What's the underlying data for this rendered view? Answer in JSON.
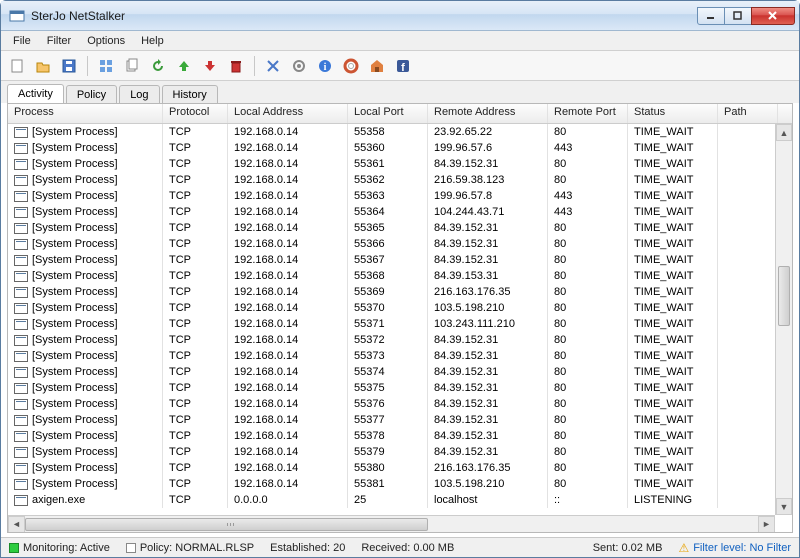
{
  "window": {
    "title": "SterJo NetStalker"
  },
  "menu": {
    "file": "File",
    "filter": "Filter",
    "options": "Options",
    "help": "Help"
  },
  "toolbar_icons": {
    "new": "new",
    "open": "open",
    "save": "save",
    "grid": "grid",
    "copy": "copy",
    "refresh": "refresh",
    "up": "up",
    "down": "down",
    "delete": "delete",
    "kill": "kill",
    "settings": "settings",
    "info": "info",
    "life": "life",
    "home": "home",
    "facebook": "facebook"
  },
  "tabs": {
    "activity": "Activity",
    "policy": "Policy",
    "log": "Log",
    "history": "History"
  },
  "columns": {
    "process": "Process",
    "protocol": "Protocol",
    "local_addr": "Local Address",
    "local_port": "Local Port",
    "remote_addr": "Remote Address",
    "remote_port": "Remote Port",
    "status": "Status",
    "path": "Path"
  },
  "rows": [
    {
      "process": "[System Process]",
      "protocol": "TCP",
      "local_addr": "192.168.0.14",
      "local_port": "55358",
      "remote_addr": "23.92.65.22",
      "remote_port": "80",
      "status": "TIME_WAIT"
    },
    {
      "process": "[System Process]",
      "protocol": "TCP",
      "local_addr": "192.168.0.14",
      "local_port": "55360",
      "remote_addr": "199.96.57.6",
      "remote_port": "443",
      "status": "TIME_WAIT"
    },
    {
      "process": "[System Process]",
      "protocol": "TCP",
      "local_addr": "192.168.0.14",
      "local_port": "55361",
      "remote_addr": "84.39.152.31",
      "remote_port": "80",
      "status": "TIME_WAIT"
    },
    {
      "process": "[System Process]",
      "protocol": "TCP",
      "local_addr": "192.168.0.14",
      "local_port": "55362",
      "remote_addr": "216.59.38.123",
      "remote_port": "80",
      "status": "TIME_WAIT"
    },
    {
      "process": "[System Process]",
      "protocol": "TCP",
      "local_addr": "192.168.0.14",
      "local_port": "55363",
      "remote_addr": "199.96.57.8",
      "remote_port": "443",
      "status": "TIME_WAIT"
    },
    {
      "process": "[System Process]",
      "protocol": "TCP",
      "local_addr": "192.168.0.14",
      "local_port": "55364",
      "remote_addr": "104.244.43.71",
      "remote_port": "443",
      "status": "TIME_WAIT"
    },
    {
      "process": "[System Process]",
      "protocol": "TCP",
      "local_addr": "192.168.0.14",
      "local_port": "55365",
      "remote_addr": "84.39.152.31",
      "remote_port": "80",
      "status": "TIME_WAIT"
    },
    {
      "process": "[System Process]",
      "protocol": "TCP",
      "local_addr": "192.168.0.14",
      "local_port": "55366",
      "remote_addr": "84.39.152.31",
      "remote_port": "80",
      "status": "TIME_WAIT"
    },
    {
      "process": "[System Process]",
      "protocol": "TCP",
      "local_addr": "192.168.0.14",
      "local_port": "55367",
      "remote_addr": "84.39.152.31",
      "remote_port": "80",
      "status": "TIME_WAIT"
    },
    {
      "process": "[System Process]",
      "protocol": "TCP",
      "local_addr": "192.168.0.14",
      "local_port": "55368",
      "remote_addr": "84.39.153.31",
      "remote_port": "80",
      "status": "TIME_WAIT"
    },
    {
      "process": "[System Process]",
      "protocol": "TCP",
      "local_addr": "192.168.0.14",
      "local_port": "55369",
      "remote_addr": "216.163.176.35",
      "remote_port": "80",
      "status": "TIME_WAIT"
    },
    {
      "process": "[System Process]",
      "protocol": "TCP",
      "local_addr": "192.168.0.14",
      "local_port": "55370",
      "remote_addr": "103.5.198.210",
      "remote_port": "80",
      "status": "TIME_WAIT"
    },
    {
      "process": "[System Process]",
      "protocol": "TCP",
      "local_addr": "192.168.0.14",
      "local_port": "55371",
      "remote_addr": "103.243.111.210",
      "remote_port": "80",
      "status": "TIME_WAIT"
    },
    {
      "process": "[System Process]",
      "protocol": "TCP",
      "local_addr": "192.168.0.14",
      "local_port": "55372",
      "remote_addr": "84.39.152.31",
      "remote_port": "80",
      "status": "TIME_WAIT"
    },
    {
      "process": "[System Process]",
      "protocol": "TCP",
      "local_addr": "192.168.0.14",
      "local_port": "55373",
      "remote_addr": "84.39.152.31",
      "remote_port": "80",
      "status": "TIME_WAIT"
    },
    {
      "process": "[System Process]",
      "protocol": "TCP",
      "local_addr": "192.168.0.14",
      "local_port": "55374",
      "remote_addr": "84.39.152.31",
      "remote_port": "80",
      "status": "TIME_WAIT"
    },
    {
      "process": "[System Process]",
      "protocol": "TCP",
      "local_addr": "192.168.0.14",
      "local_port": "55375",
      "remote_addr": "84.39.152.31",
      "remote_port": "80",
      "status": "TIME_WAIT"
    },
    {
      "process": "[System Process]",
      "protocol": "TCP",
      "local_addr": "192.168.0.14",
      "local_port": "55376",
      "remote_addr": "84.39.152.31",
      "remote_port": "80",
      "status": "TIME_WAIT"
    },
    {
      "process": "[System Process]",
      "protocol": "TCP",
      "local_addr": "192.168.0.14",
      "local_port": "55377",
      "remote_addr": "84.39.152.31",
      "remote_port": "80",
      "status": "TIME_WAIT"
    },
    {
      "process": "[System Process]",
      "protocol": "TCP",
      "local_addr": "192.168.0.14",
      "local_port": "55378",
      "remote_addr": "84.39.152.31",
      "remote_port": "80",
      "status": "TIME_WAIT"
    },
    {
      "process": "[System Process]",
      "protocol": "TCP",
      "local_addr": "192.168.0.14",
      "local_port": "55379",
      "remote_addr": "84.39.152.31",
      "remote_port": "80",
      "status": "TIME_WAIT"
    },
    {
      "process": "[System Process]",
      "protocol": "TCP",
      "local_addr": "192.168.0.14",
      "local_port": "55380",
      "remote_addr": "216.163.176.35",
      "remote_port": "80",
      "status": "TIME_WAIT"
    },
    {
      "process": "[System Process]",
      "protocol": "TCP",
      "local_addr": "192.168.0.14",
      "local_port": "55381",
      "remote_addr": "103.5.198.210",
      "remote_port": "80",
      "status": "TIME_WAIT"
    },
    {
      "process": "axigen.exe",
      "protocol": "TCP",
      "local_addr": "0.0.0.0",
      "local_port": "25",
      "remote_addr": "localhost",
      "remote_port": "::",
      "status": "LISTENING"
    }
  ],
  "status": {
    "monitoring": "Monitoring: Active",
    "policy": "Policy: NORMAL.RLSP",
    "established": "Established: 20",
    "received": "Received: 0.00 MB",
    "sent": "Sent: 0.02 MB",
    "filter": "Filter level: No Filter"
  }
}
